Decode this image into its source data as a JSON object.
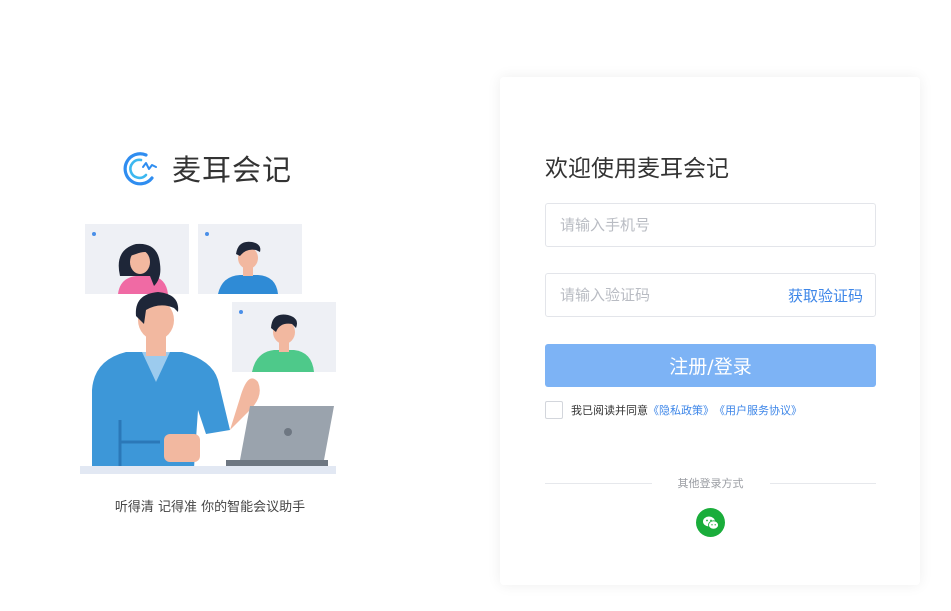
{
  "brand": {
    "name": "麦耳会记",
    "tagline": "听得清 记得准 你的智能会议助手",
    "accent_color": "#3d86e8"
  },
  "login": {
    "title": "欢迎使用麦耳会记",
    "phone_placeholder": "请输入手机号",
    "code_placeholder": "请输入验证码",
    "get_code_label": "获取验证码",
    "submit_label": "注册/登录",
    "submit_color": "#7db3f5",
    "agree_text": "我已阅读并同意",
    "privacy_link": "《隐私政策》",
    "terms_link": "《用户服务协议》",
    "other_login_label": "其他登录方式",
    "wechat_icon": "wechat-icon",
    "wechat_color": "#1aad3b"
  }
}
